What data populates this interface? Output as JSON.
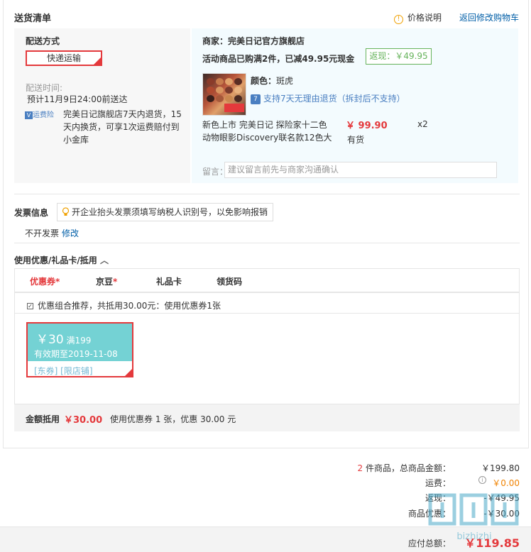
{
  "delivery": {
    "title": "送货清单",
    "price_note": "价格说明",
    "back_link": "返回修改购物车",
    "method_label": "配送方式",
    "method_value": "快递运输",
    "time_label": "配送时间:",
    "time_value": "预计11月9日24:00前送达",
    "insurance_badge": "运费险",
    "insurance_text_1": "美日记旗舰店7天内退货，15",
    "insurance_text_1_prefix": "完",
    "insurance_text_2": "天内换货，可享1次运费赔付到",
    "insurance_text_3": "小金库"
  },
  "merchant": {
    "label": "商家：",
    "name": "完美日记官方旗舰店",
    "promo": "活动商品已购满2件，已减49.95元现金",
    "rebate": "返现：￥49.95",
    "color_label": "颜色：",
    "color_value": "斑虎",
    "return_icon": "return-icon",
    "return_text": "支持7天无理由退货（拆封后不支持）",
    "product_line1": "新色上市 完美日记 探险家十二色",
    "product_line2": "动物眼影Discovery联名款12色大",
    "price": "￥ 99.90",
    "qty": "x2",
    "stock": "有货",
    "memo_label": "留言：",
    "memo_placeholder": "建议留言前先与商家沟通确认"
  },
  "invoice": {
    "title": "发票信息",
    "tip": "开企业抬头发票须填写纳税人识别号，以免影响报销",
    "value": "不开发票",
    "edit": "修改"
  },
  "coupons": {
    "title": "使用优惠/礼品卡/抵用",
    "tabs": [
      "优惠券",
      "京豆",
      "礼品卡",
      "领货码"
    ],
    "tab_marks": [
      "*",
      "*"
    ],
    "recommend": "优惠组合推荐，共抵用30.00元：使用优惠券1张",
    "card_amount": "￥30",
    "card_threshold": "满199",
    "card_expiry": "有效期至2019-11-08",
    "card_tags": "[东券] [限店铺]",
    "discount_label": "金额抵用",
    "discount_value": "￥30.00",
    "discount_desc": "使用优惠券 1 张，优惠 30.00 元"
  },
  "summary": {
    "count": "2",
    "count_label": " 件商品，总商品金额：",
    "total": "￥199.80",
    "freight_label": "运费：",
    "freight": "￥0.00",
    "rebate_label": "返现：",
    "rebate": "-￥49.95",
    "discount_label": "商品优惠：",
    "discount": "-￥30.00",
    "payable_label": "应付总额：",
    "payable": "￥119.85"
  },
  "colors": {
    "accent": "#e4393c",
    "link": "#005ea7",
    "coupon": "#74d2d4",
    "rebate": "#66b35b"
  }
}
